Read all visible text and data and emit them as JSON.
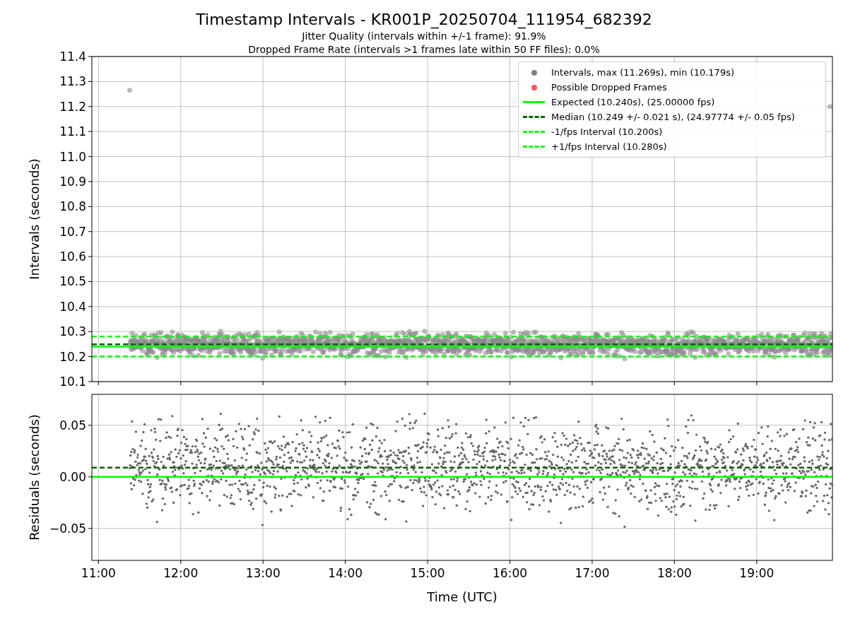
{
  "title": "Timestamp Intervals - KR001P_20250704_111954_682392",
  "subtitles": [
    "Jitter Quality (intervals within +/-1 frame): 91.9%",
    "Dropped Frame Rate (intervals >1 frames late within 50 FF files): 0.0%"
  ],
  "intervals_plot": {
    "legend_points": [
      {
        "label": "Intervals, max (11.269s), min (10.179s)",
        "color": "#808080"
      },
      {
        "label": "Possible Dropped Frames",
        "color": "#ff5555"
      }
    ],
    "chart_data": {
      "type": "line",
      "ylabel": "Intervals (seconds)",
      "xlim": [
        10.92,
        19.92
      ],
      "ylim": [
        10.1,
        11.4
      ],
      "x": [
        10.92,
        19.92
      ],
      "series": [
        {
          "name": "Expected (10.240s), (25.00000 fps)",
          "color": "#00ff00",
          "line_style": "solid",
          "values": [
            10.24,
            10.24
          ]
        },
        {
          "name": "Median (10.249 +/- 0.021 s), (24.97774 +/- 0.05 fps)",
          "color": "#006400",
          "line_style": "dashed",
          "values": [
            10.249,
            10.249
          ]
        },
        {
          "name": "-1/fps Interval (10.200s)",
          "color": "#00ff00",
          "line_style": "dashed",
          "values": [
            10.2,
            10.2
          ]
        },
        {
          "name": "+1/fps Interval (10.280s)",
          "color": "#00ff00",
          "line_style": "dashed",
          "values": [
            10.28,
            10.28
          ]
        }
      ],
      "grid": true,
      "yticks": [
        {
          "value": 10.1,
          "label": "10.1"
        },
        {
          "value": 10.2,
          "label": "10.2"
        },
        {
          "value": 10.3,
          "label": "10.3"
        },
        {
          "value": 10.4,
          "label": "10.4"
        },
        {
          "value": 10.5,
          "label": "10.5"
        },
        {
          "value": 10.6,
          "label": "10.6"
        },
        {
          "value": 10.7,
          "label": "10.7"
        },
        {
          "value": 10.8,
          "label": "10.8"
        },
        {
          "value": 10.9,
          "label": "10.9"
        },
        {
          "value": 11.0,
          "label": "11.0"
        },
        {
          "value": 11.1,
          "label": "11.1"
        },
        {
          "value": 11.2,
          "label": "11.2"
        },
        {
          "value": 11.3,
          "label": "11.3"
        },
        {
          "value": 11.4,
          "label": "11.4"
        }
      ]
    }
  },
  "residuals_plot": {
    "chart_data": {
      "type": "line",
      "xlabel": "Time (UTC)",
      "ylabel": "Residuals (seconds)",
      "xlim": [
        10.92,
        19.92
      ],
      "ylim": [
        -0.081,
        0.08
      ],
      "x": [
        10.92,
        19.92
      ],
      "series": [
        {
          "color": "#006400",
          "line_style": "dashed",
          "values": [
            0.009,
            0.009
          ]
        },
        {
          "color": "#00ff00",
          "line_style": "solid",
          "values": [
            0,
            0
          ]
        }
      ],
      "grid": true,
      "xticks": [
        {
          "value": 11,
          "label": "11:00"
        },
        {
          "value": 12,
          "label": "12:00"
        },
        {
          "value": 13,
          "label": "13:00"
        },
        {
          "value": 14,
          "label": "14:00"
        },
        {
          "value": 15,
          "label": "15:00"
        },
        {
          "value": 16,
          "label": "16:00"
        },
        {
          "value": 17,
          "label": "17:00"
        },
        {
          "value": 18,
          "label": "18:00"
        },
        {
          "value": 19,
          "label": "19:00"
        }
      ],
      "yticks": [
        {
          "value": 0.05,
          "label": "0.05"
        },
        {
          "value": 0,
          "label": "0.00"
        },
        {
          "value": -0.05,
          "label": "−0.05"
        }
      ]
    }
  }
}
